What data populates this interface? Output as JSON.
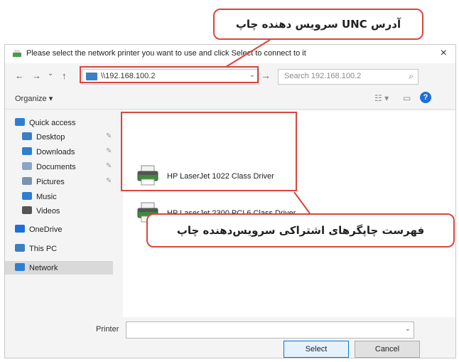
{
  "dialog": {
    "title": "Please select the network printer you want to use and click Select to connect to it",
    "close": "×"
  },
  "nav": {
    "back": "←",
    "forward": "→",
    "recent": "⌄",
    "up": "↑",
    "address": "\\\\192.168.100.2",
    "go": "→",
    "search_placeholder": "Search 192.168.100.2"
  },
  "toolbar": {
    "organize": "Organize ▾"
  },
  "sidebar": {
    "items": [
      {
        "label": "Quick access",
        "icon": "star-icon",
        "color": "#2d7fd3"
      },
      {
        "label": "Desktop",
        "icon": "desktop-icon",
        "color": "#3b7fc4"
      },
      {
        "label": "Downloads",
        "icon": "download-icon",
        "color": "#2d7fd3"
      },
      {
        "label": "Documents",
        "icon": "documents-icon",
        "color": "#8aa6c4"
      },
      {
        "label": "Pictures",
        "icon": "pictures-icon",
        "color": "#7b93ad"
      },
      {
        "label": "Music",
        "icon": "music-icon",
        "color": "#2d7fd3"
      },
      {
        "label": "Videos",
        "icon": "videos-icon",
        "color": "#555555"
      },
      {
        "label": "OneDrive",
        "icon": "onedrive-icon",
        "color": "#1e6fd9"
      },
      {
        "label": "This PC",
        "icon": "pc-icon",
        "color": "#3b7fc4"
      },
      {
        "label": "Network",
        "icon": "network-icon",
        "color": "#2d7fd3"
      }
    ]
  },
  "printers": [
    {
      "name": "HP LaserJet 1022 Class Driver"
    },
    {
      "name": "HP LaserJet 2300 PCL6 Class Driver"
    }
  ],
  "footer": {
    "printer_label": "Printer",
    "printer_value": "",
    "select_label": "Select",
    "cancel_label": "Cancel"
  },
  "callouts": {
    "top": "آدرس UNC سرویس دهنده چاپ",
    "bottom": "فهرست چاپگرهای اشتراکی سرویس‌دهنده چاپ"
  },
  "colors": {
    "accent": "#d9463e",
    "selected": "#0078d7"
  }
}
